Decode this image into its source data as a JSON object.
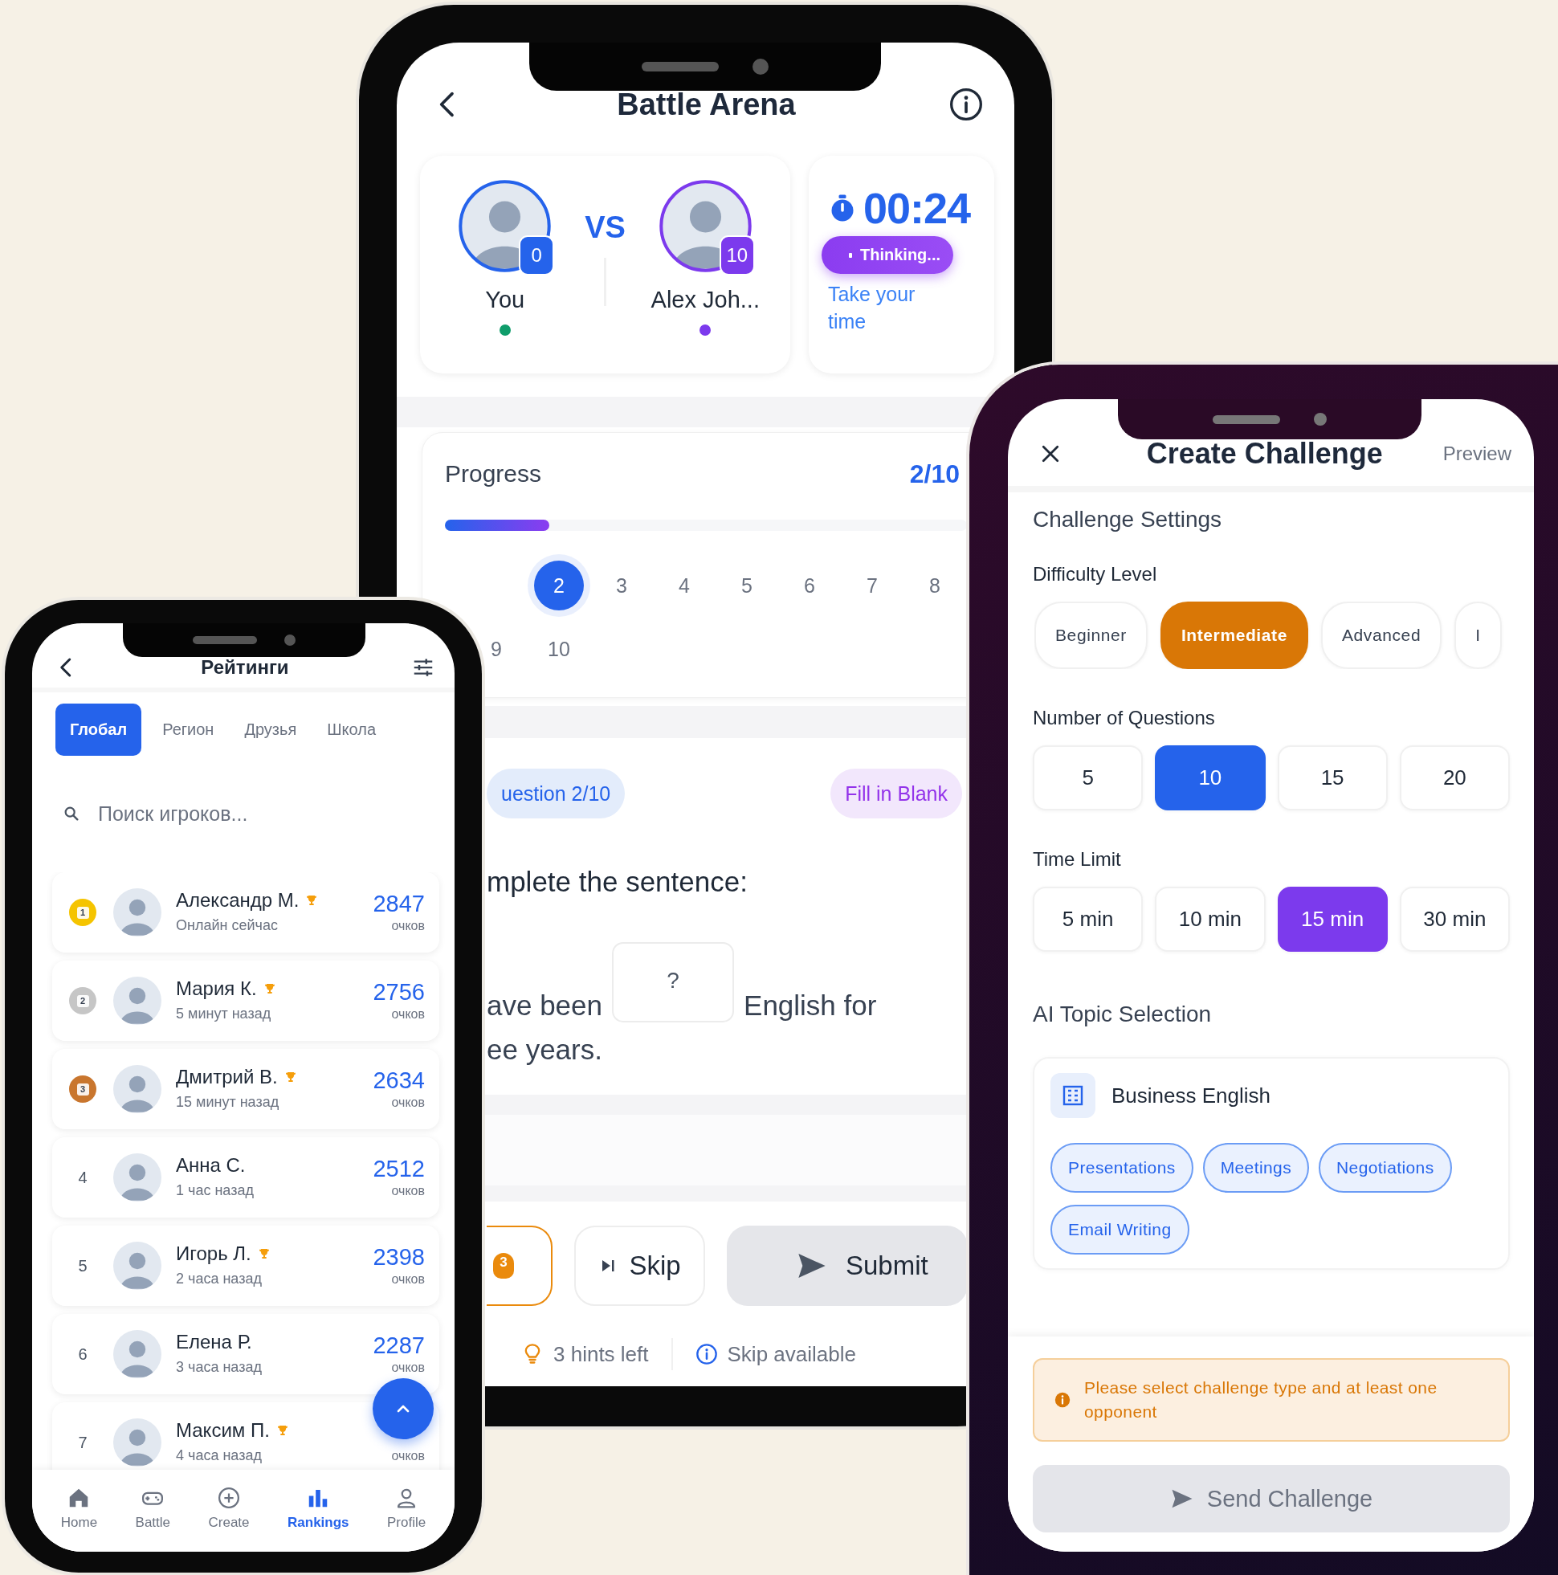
{
  "battle": {
    "title": "Battle Arena",
    "vs": "VS",
    "players": [
      {
        "name": "You",
        "score": "0",
        "color": "#2563eb",
        "status": {
          "color": "#0f9d6b"
        }
      },
      {
        "name": "Alex Joh...",
        "score": "10",
        "color": "#7c3aed",
        "status": {
          "color": "#7c3aed"
        }
      }
    ],
    "timer": {
      "time": "00:24",
      "status": "Thinking...",
      "note": "Take your time"
    },
    "progress": {
      "title": "Progress",
      "count": "2/10",
      "level": 0.2,
      "steps": [
        {
          "label": "2",
          "selected": true
        },
        {
          "label": "3",
          "selected": false
        },
        {
          "label": "4",
          "selected": false
        },
        {
          "label": "5",
          "selected": false
        },
        {
          "label": "6",
          "selected": false
        },
        {
          "label": "7",
          "selected": false
        },
        {
          "label": "8",
          "selected": false
        },
        {
          "label": "9",
          "selected": false
        },
        {
          "label": "10",
          "selected": false
        }
      ]
    },
    "question": {
      "number": "uestion 2/10",
      "type": "Fill in Blank",
      "prompt": "mplete the sentence:",
      "before": "ave been",
      "blank": "?",
      "after": "English for",
      "end": "ee years."
    },
    "actions": [
      {
        "kind": "hint",
        "badge": "3"
      },
      {
        "kind": "skip",
        "label": "Skip"
      },
      {
        "kind": "submit",
        "label": "Submit"
      }
    ],
    "info": [
      {
        "kind": "hints",
        "text": "3 hints left"
      },
      {
        "kind": "skip",
        "text": "Skip available"
      }
    ]
  },
  "rankings": {
    "title": "Рейтинги",
    "tabs": [
      {
        "label": "Глобал",
        "selected": true
      },
      {
        "label": "Регион",
        "selected": false
      },
      {
        "label": "Друзья",
        "selected": false
      },
      {
        "label": "Школа",
        "selected": false
      }
    ],
    "search": {
      "placeholder": "Поиск игроков..."
    },
    "players": [
      {
        "rank": "1",
        "kind": "medal",
        "color": "#f5c400",
        "name": "Александр М.",
        "trophy": true,
        "status": "Онлайн сейчас",
        "points": "2847",
        "unit": "очков"
      },
      {
        "rank": "2",
        "kind": "medal",
        "color": "#c6c6c6",
        "name": "Мария К.",
        "trophy": true,
        "status": "5 минут назад",
        "points": "2756",
        "unit": "очков"
      },
      {
        "rank": "3",
        "kind": "medal",
        "color": "#c9762e",
        "name": "Дмитрий В.",
        "trophy": true,
        "status": "15 минут назад",
        "points": "2634",
        "unit": "очков"
      },
      {
        "rank": "4",
        "kind": "plain",
        "name": "Анна С.",
        "trophy": false,
        "status": "1 час назад",
        "points": "2512",
        "unit": "очков"
      },
      {
        "rank": "5",
        "kind": "plain",
        "name": "Игорь Л.",
        "trophy": true,
        "status": "2 часа назад",
        "points": "2398",
        "unit": "очков"
      },
      {
        "rank": "6",
        "kind": "plain",
        "name": "Елена Р.",
        "trophy": false,
        "status": "3 часа назад",
        "points": "2287",
        "unit": "очков"
      },
      {
        "rank": "7",
        "kind": "plain",
        "name": "Максим П.",
        "trophy": true,
        "status": "4 часа назад",
        "unit": "очков"
      }
    ],
    "nav": [
      {
        "label": "Home",
        "kind": "home",
        "selected": false
      },
      {
        "label": "Battle",
        "kind": "battle",
        "selected": false
      },
      {
        "label": "Create",
        "kind": "create",
        "selected": false
      },
      {
        "label": "Rankings",
        "kind": "rankings",
        "selected": true
      },
      {
        "label": "Profile",
        "kind": "profile",
        "selected": false
      }
    ]
  },
  "challenge": {
    "title": "Create Challenge",
    "preview": "Preview",
    "section": "Challenge Settings",
    "groups": [
      {
        "label": "Difficulty Level",
        "kind": "pill",
        "color": "#d97706",
        "options": [
          {
            "label": "Beginner",
            "selected": false
          },
          {
            "label": "Intermediate",
            "selected": true
          },
          {
            "label": "Advanced",
            "selected": false
          },
          {
            "label": "I",
            "selected": false
          }
        ]
      },
      {
        "label": "Number of Questions",
        "kind": "tile",
        "color": "#2563eb",
        "options": [
          {
            "label": "5",
            "selected": false
          },
          {
            "label": "10",
            "selected": true
          },
          {
            "label": "15",
            "selected": false
          },
          {
            "label": "20",
            "selected": false
          }
        ]
      },
      {
        "label": "Time Limit",
        "kind": "tile",
        "color": "#7c3aed",
        "options": [
          {
            "label": "5 min",
            "selected": false
          },
          {
            "label": "10 min",
            "selected": false
          },
          {
            "label": "15 min",
            "selected": true
          },
          {
            "label": "30 min",
            "selected": false
          }
        ]
      }
    ],
    "topics": {
      "title": "AI Topic Selection",
      "cards": [
        {
          "name": "Business English",
          "tags": [
            "Presentations",
            "Meetings",
            "Negotiations",
            "Email Writing"
          ]
        }
      ]
    },
    "warning": "Please select challenge type and at least one opponent",
    "send": {
      "label": "Send Challenge",
      "disabled": true
    }
  }
}
